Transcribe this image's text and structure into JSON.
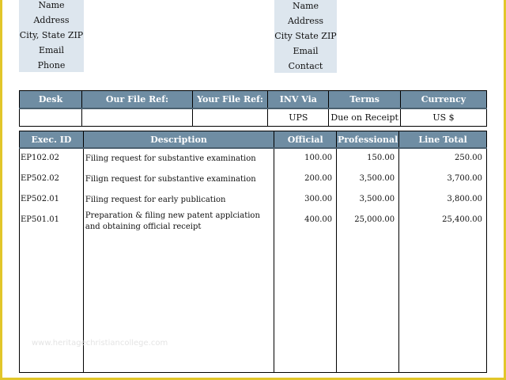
{
  "sender": {
    "lines": [
      "Name",
      "Address",
      "City, State ZIP",
      "Email",
      "Phone"
    ]
  },
  "recipient": {
    "lines": [
      "Name",
      "Address",
      "City State ZIP",
      "Email",
      "Contact"
    ]
  },
  "info_table": {
    "headers": [
      "Desk",
      "Our File Ref:",
      "Your File Ref:",
      "INV Via",
      "Terms",
      "Currency"
    ],
    "values": [
      "",
      "",
      "",
      "UPS",
      "Due on Receipt",
      "US $"
    ]
  },
  "items_table": {
    "headers": [
      "Exec. ID",
      "Description",
      "Official",
      "Professional",
      "Line Total"
    ],
    "rows": [
      {
        "id": "EP102.02",
        "description": "Filing request for substantive examination",
        "official": "100.00",
        "professional": "150.00",
        "total": "250.00"
      },
      {
        "id": "EP502.02",
        "description": "Filign request for substantive examination",
        "official": "200.00",
        "professional": "3,500.00",
        "total": "3,700.00"
      },
      {
        "id": "EP502.01",
        "description": "Filing request for early publication",
        "official": "300.00",
        "professional": "3,500.00",
        "total": "3,800.00"
      },
      {
        "id": "EP501.01",
        "description": "Preparation & filing new patent applciation and obtaining official receipt",
        "official": "400.00",
        "professional": "25,000.00",
        "total": "25,400.00"
      }
    ]
  },
  "watermark": "www.heritagechristiancollege.com",
  "colors": {
    "header_bg": "#6f8da3",
    "address_bg": "#dde6ee",
    "frame": "#e2c62a"
  }
}
